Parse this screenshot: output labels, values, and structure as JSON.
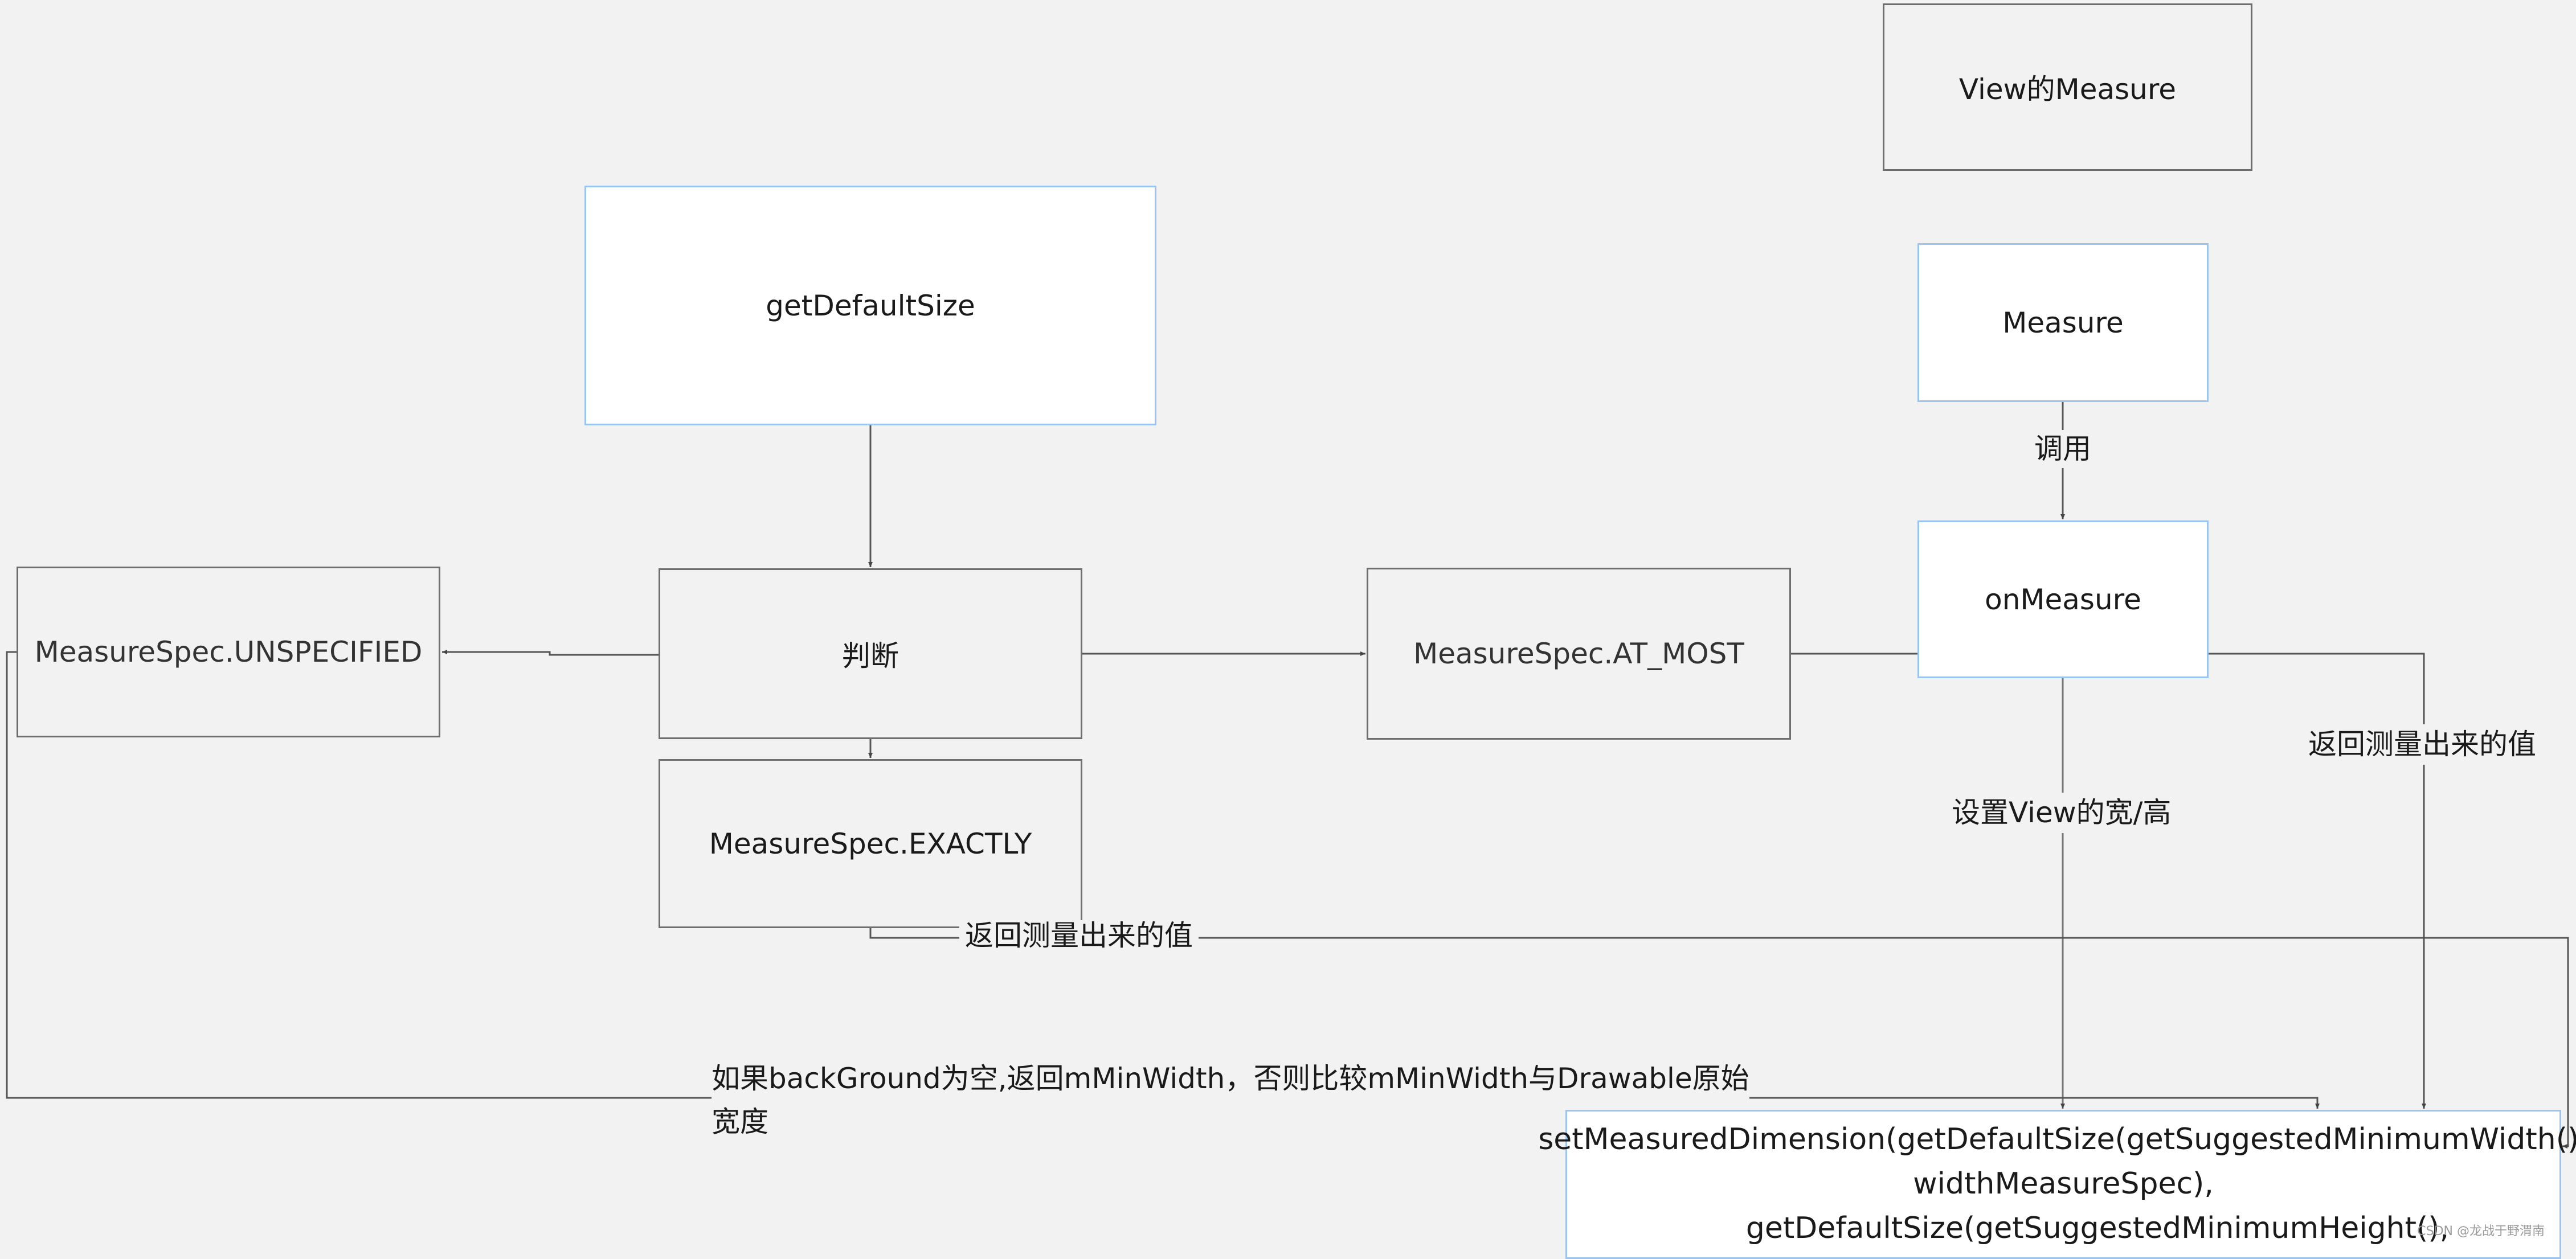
{
  "title_box": "View的Measure",
  "nodes": {
    "get_default_size": "getDefaultSize",
    "unspecified": "MeasureSpec.UNSPECIFIED",
    "judge": "判断",
    "exactly": "MeasureSpec.EXACTLY",
    "at_most": "MeasureSpec.AT_MOST",
    "measure": "Measure",
    "on_measure": "onMeasure",
    "set_measured_dimension": {
      "line1": "setMeasuredDimension(getDefaultSize(getSuggestedMinimumWidth(),",
      "line2": "widthMeasureSpec),",
      "line3": "getDefaultSize(getSuggestedMinimumHeight(),"
    }
  },
  "edge_labels": {
    "call": "调用",
    "set_view_size": "设置View的宽/高",
    "return_value_right": "返回测量出来的值",
    "return_value_mid": "返回测量出来的值",
    "background_rule_line1": "如果backGround为空,返回mMinWidth，否则比较mMinWidth与Drawable原始",
    "background_rule_line2": "宽度"
  },
  "colors": {
    "background": "#f2f2f2",
    "gray_border": "#6e6e6e",
    "blue_border": "#9cc4ef",
    "line": "#555555"
  },
  "watermark": "CSDN @龙战于野渭南"
}
